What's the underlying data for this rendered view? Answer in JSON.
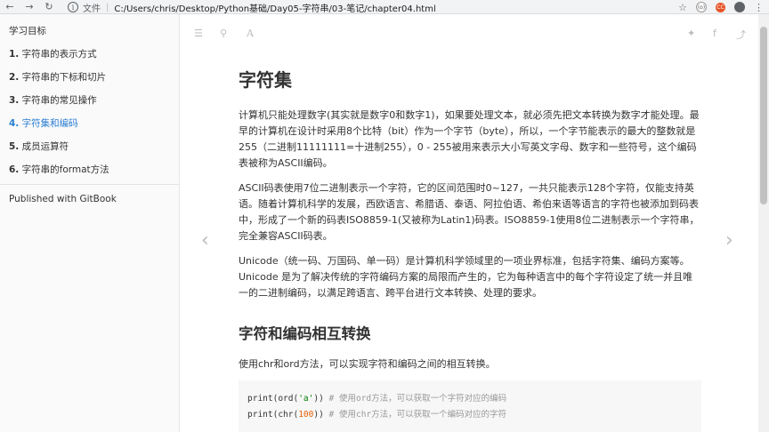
{
  "browser": {
    "info_icon": "i",
    "page_label": "文件",
    "url": "C:/Users/chris/Desktop/Python基础/Day05-字符串/03-笔记/chapter04.html",
    "ext1": "(o)",
    "ext2": "CC"
  },
  "sidebar": {
    "title": "学习目标",
    "items": [
      {
        "num": "1.",
        "label": "字符串的表示方式"
      },
      {
        "num": "2.",
        "label": "字符串的下标和切片"
      },
      {
        "num": "3.",
        "label": "字符串的常见操作"
      },
      {
        "num": "4.",
        "label": "字符集和编码"
      },
      {
        "num": "5.",
        "label": "成员运算符"
      },
      {
        "num": "6.",
        "label": "字符串的format方法"
      }
    ],
    "footer": "Published with GitBook",
    "active_color": "#2b7fd3"
  },
  "article": {
    "h1": "字符集",
    "p1": "计算机只能处理数字(其实就是数字0和数字1)，如果要处理文本，就必须先把文本转换为数字才能处理。最早的计算机在设计时采用8个比特（bit）作为一个字节（byte），所以，一个字节能表示的最大的整数就是255（二进制11111111=十进制255），0 - 255被用来表示大小写英文字母、数字和一些符号，这个编码表被称为ASCII编码。",
    "p2": "ASCII码表使用7位二进制表示一个字符，它的区间范围时0~127，一共只能表示128个字符，仅能支持英语。随着计算机科学的发展，西欧语言、希腊语、泰语、阿拉伯语、希伯来语等语言的字符也被添加到码表中，形成了一个新的码表ISO8859-1(又被称为Latin1)码表。ISO8859-1使用8位二进制表示一个字符串，完全兼容ASCII码表。",
    "p3": "Unicode（统一码、万国码、单一码）是计算机科学领域里的一项业界标准，包括字符集、编码方案等。Unicode 是为了解决传统的字符编码方案的局限而产生的，它为每种语言中的每个字符设定了统一并且唯一的二进制编码，以满足跨语言、跨平台进行文本转换、处理的要求。",
    "h2": "字符和编码相互转换",
    "p4": "使用chr和ord方法，可以实现字符和编码之间的相互转换。",
    "code": [
      {
        "pre": "print(ord(",
        "lit": "'a'",
        "post": "))  ",
        "comment": "# 使用ord方法，可以获取一个字符对应的编码"
      },
      {
        "pre": "print(chr(",
        "lit": "100",
        "post": "))  ",
        "comment": "# 使用chr方法，可以获取一个编码对应的字符"
      }
    ]
  }
}
